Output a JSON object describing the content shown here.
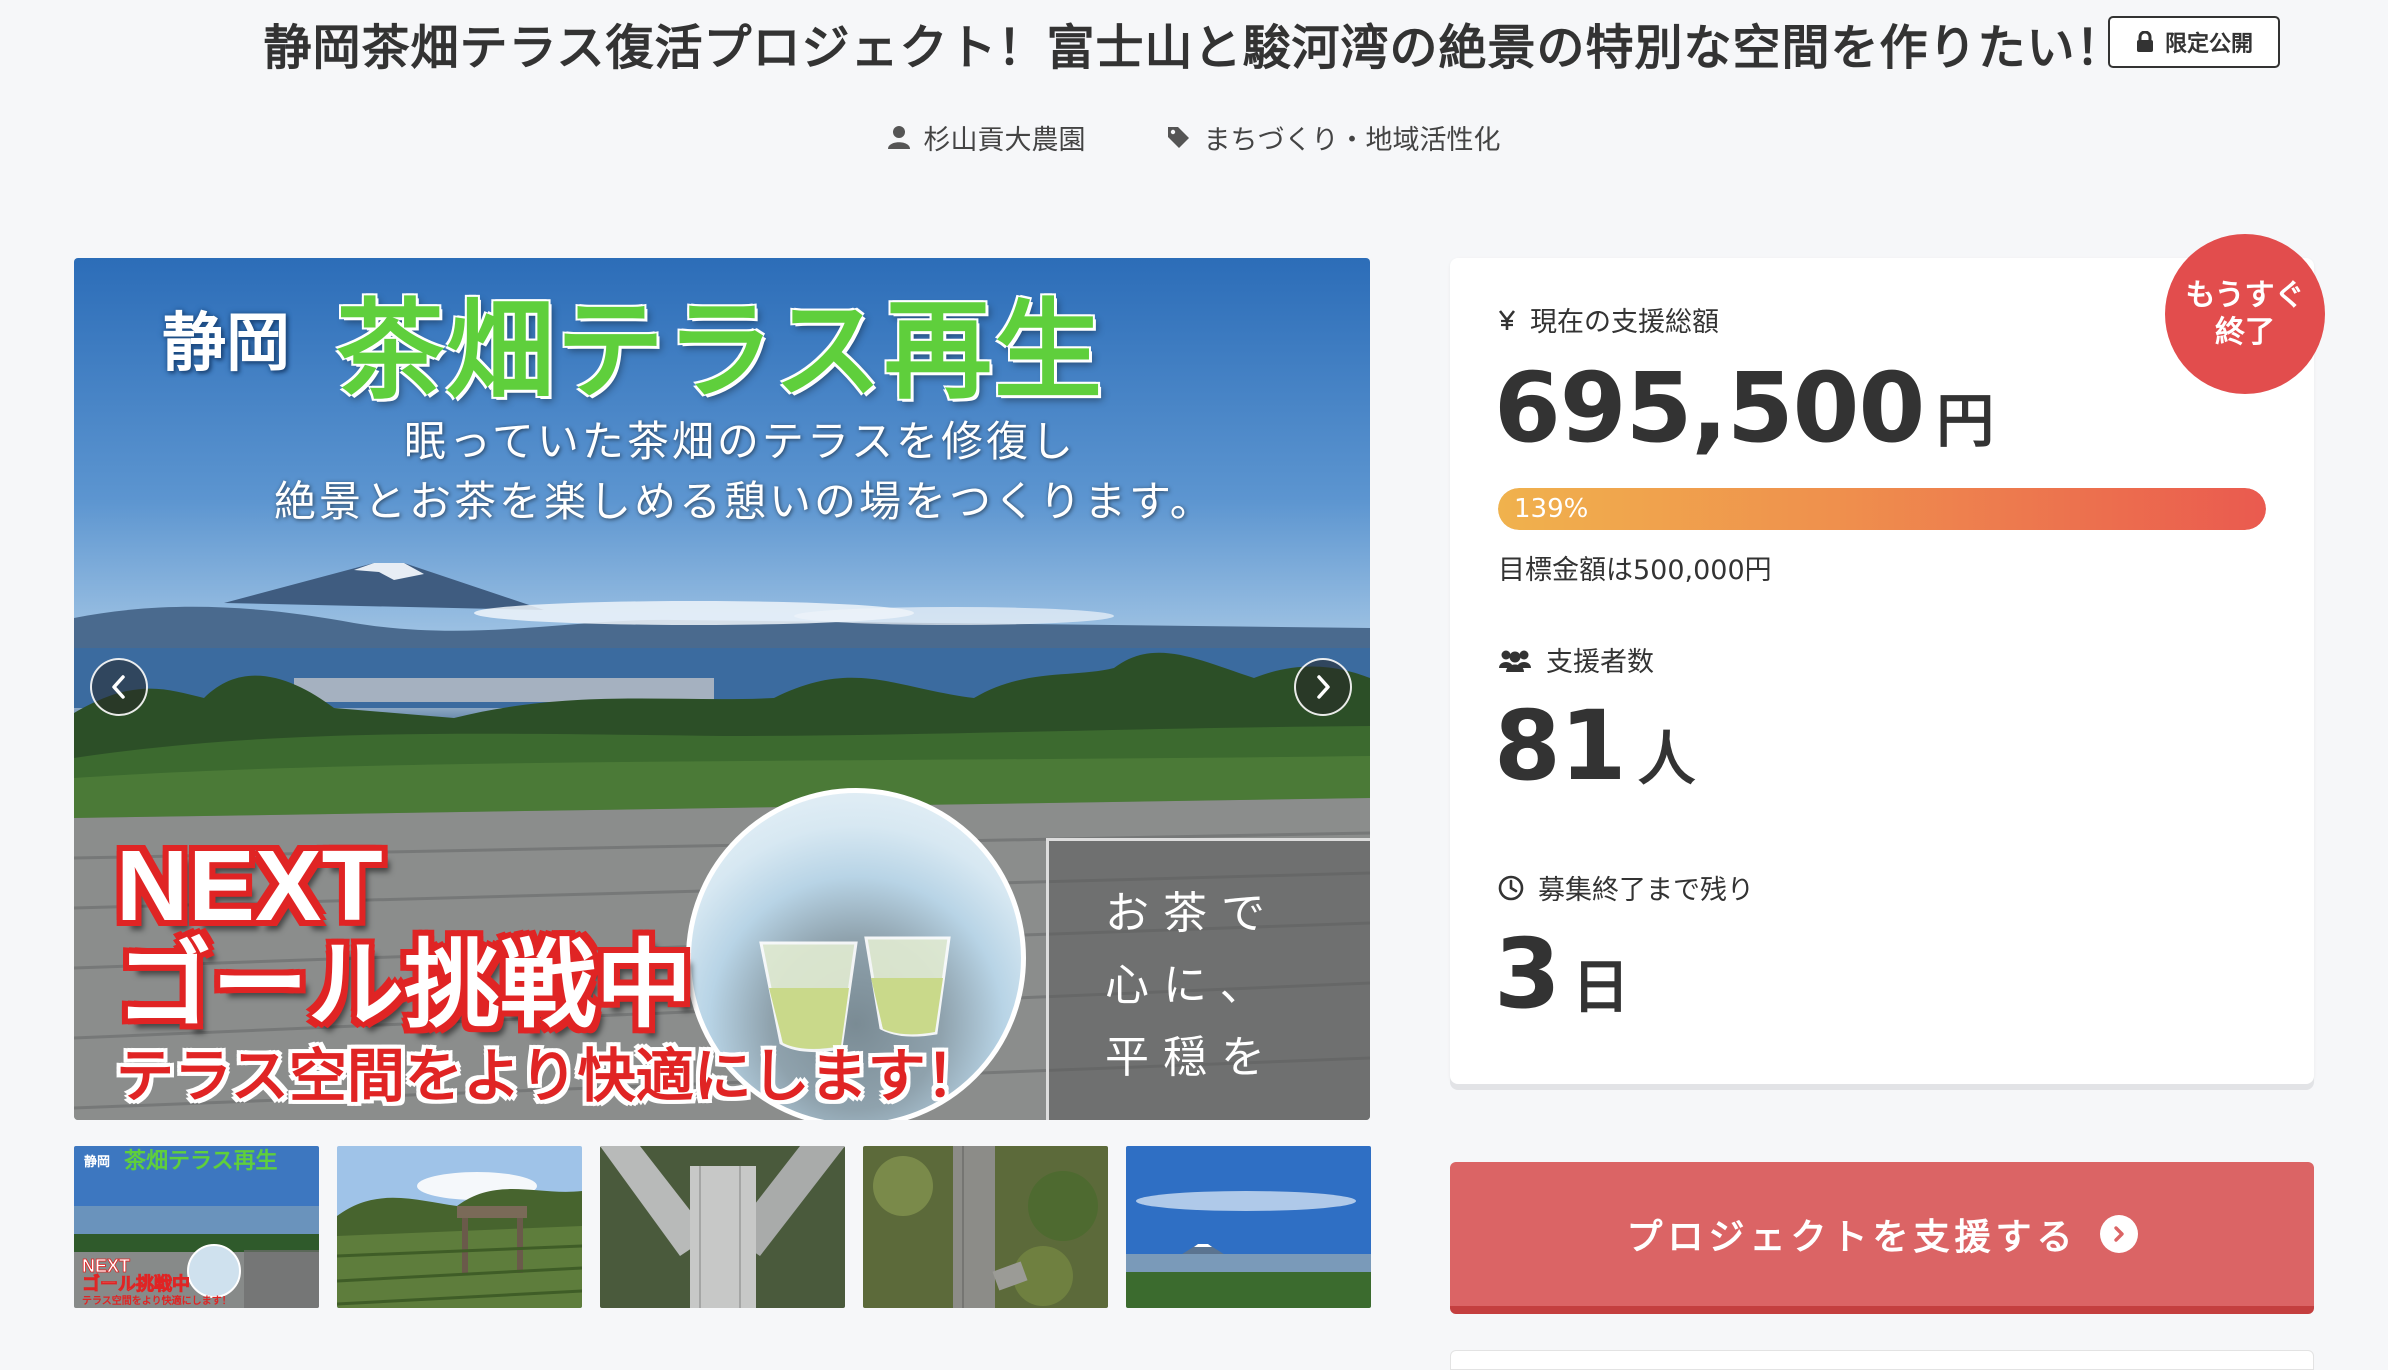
{
  "header": {
    "title": "静岡茶畑テラス復活プロジェクト！富士山と駿河湾の絶景の特別な空間を作りたい！",
    "badge_label": "限定公開",
    "owner": "杉山貢大農園",
    "category": "まちづくり・地域活性化"
  },
  "main_visual": {
    "city": "静岡",
    "main_title": "茶畑テラス再生",
    "subtitle_line1": "眠っていた茶畑のテラスを修復し",
    "subtitle_line2": "絶景とお茶を楽しめる憩いの場をつくります。",
    "next_label": "NEXT",
    "goal_challenge": "ゴール挑戦中",
    "terrace_comfort": "テラス空間をより快適にします！",
    "side_line1": "お茶で",
    "side_line2": "心に、",
    "side_line3": "平穏を"
  },
  "thumbnail_mini_text": {
    "city": "静岡",
    "title": "茶畑テラス再生",
    "next": "NEXT",
    "goal": "ゴール挑戦中",
    "terrace": "テラス空間をより快適にします！"
  },
  "stats": {
    "ending_badge_line1": "もうすぐ",
    "ending_badge_line2": "終了",
    "total_label": "現在の支援総額",
    "total_amount": "695,500",
    "currency_unit": "円",
    "progress_percent": 139,
    "progress_label": "139%",
    "goal_text": "目標金額は500,000円",
    "supporters_label": "支援者数",
    "supporters_count": "81",
    "supporters_unit": "人",
    "remaining_label": "募集終了まで残り",
    "remaining_days": "3",
    "remaining_unit": "日"
  },
  "support_button": {
    "label": "プロジェクトを支援する"
  },
  "icons": {
    "lock": "lock-icon",
    "user": "user-icon",
    "tag": "tag-icon",
    "yen": "yen-icon",
    "users": "users-icon",
    "clock": "clock-icon",
    "prev": "chevron-left-icon",
    "next": "chevron-right-icon",
    "arrow": "arrow-right-circle-icon"
  },
  "colors": {
    "accent_red": "#db6465",
    "badge_red": "#e24d4d",
    "progress_start": "#f0b24d",
    "progress_end": "#ea5a4f",
    "text": "#333333",
    "background": "#f6f7f9"
  }
}
